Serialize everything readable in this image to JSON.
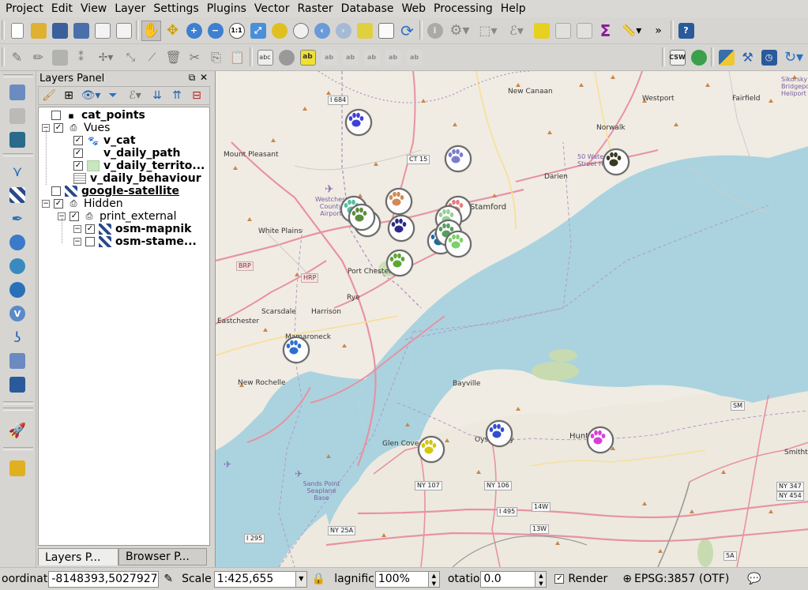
{
  "menu": [
    "Project",
    "Edit",
    "View",
    "Layer",
    "Settings",
    "Plugins",
    "Vector",
    "Raster",
    "Database",
    "Web",
    "Processing",
    "Help"
  ],
  "toolbar": {
    "csw_label": "CSW",
    "label_abc": "abc",
    "overflow": "»",
    "sigma": "Σ"
  },
  "panel": {
    "title": "Layers Panel",
    "float_glyph": "⧉",
    "close_glyph": "✕",
    "layers": [
      {
        "label": "cat_points",
        "checked": false,
        "bold": true
      },
      {
        "label": "Vues",
        "checked": true,
        "group": true
      },
      {
        "label": "v_cat",
        "checked": true,
        "bold": true
      },
      {
        "label": "v_daily_path",
        "checked": true,
        "bold": true
      },
      {
        "label": "v_daily_territo...",
        "checked": true,
        "bold": true
      },
      {
        "label": "v_daily_behaviour",
        "bold": true
      },
      {
        "label": "google-satellite",
        "checked": false,
        "bold": true
      },
      {
        "label": "Hidden",
        "checked": true,
        "group": true
      },
      {
        "label": "print_external",
        "checked": true,
        "group": true
      },
      {
        "label": "osm-mapnik",
        "checked": true,
        "bold": true
      },
      {
        "label": "osm-stame...",
        "checked": false,
        "bold": true
      }
    ],
    "tabs": [
      "Layers P...",
      "Browser P..."
    ]
  },
  "map": {
    "labels": [
      "New Canaan",
      "Westport",
      "Fairfield",
      "Mount Pleasant",
      "Norwalk",
      "Darien",
      "Stamford",
      "White Plains",
      "Port Chester",
      "Rye",
      "Scarsdale",
      "Harrison",
      "Eastchester",
      "Mamaroneck",
      "New Rochelle",
      "Bayville",
      "Glen Cove",
      "Oyster Bay",
      "Huntington",
      "Smithtown",
      "Westchester County Airport",
      "Sands Point Seaplane Base",
      "50 Water Street Helipo",
      "Sikorsky Bridgeport Heliport"
    ],
    "shields": [
      "I 684",
      "CT 15",
      "BRP",
      "HRP",
      "NY 107",
      "NY 106",
      "NY 25A",
      "I 495",
      "I 295",
      "SM",
      "NY 347",
      "NY 454",
      "5A",
      "14W",
      "13W"
    ],
    "marker_colors": [
      "#3f3fd8",
      "#7c7ccc",
      "#3a3a20",
      "#d08a56",
      "#4fbf9f",
      "#e6d800",
      "#5b8c3a",
      "#e08080",
      "#98cf95",
      "#2a2a8a",
      "#5aa830",
      "#1a6aa0",
      "#5a9c60",
      "#7dd06a",
      "#2d6fd0",
      "#d4c70a",
      "#2f4fd0",
      "#d63fd6"
    ]
  },
  "status": {
    "coord_label": "oordinat",
    "coord_value": "-8148393,5027927",
    "scale_label": "Scale",
    "scale_value": "1:425,655",
    "magnifier_label": "lagnific",
    "magnifier_value": "100%",
    "rotation_label": "otatio",
    "rotation_value": "0.0",
    "render_label": "Render",
    "render_checked": true,
    "crs_label": "EPSG:3857 (OTF)"
  }
}
